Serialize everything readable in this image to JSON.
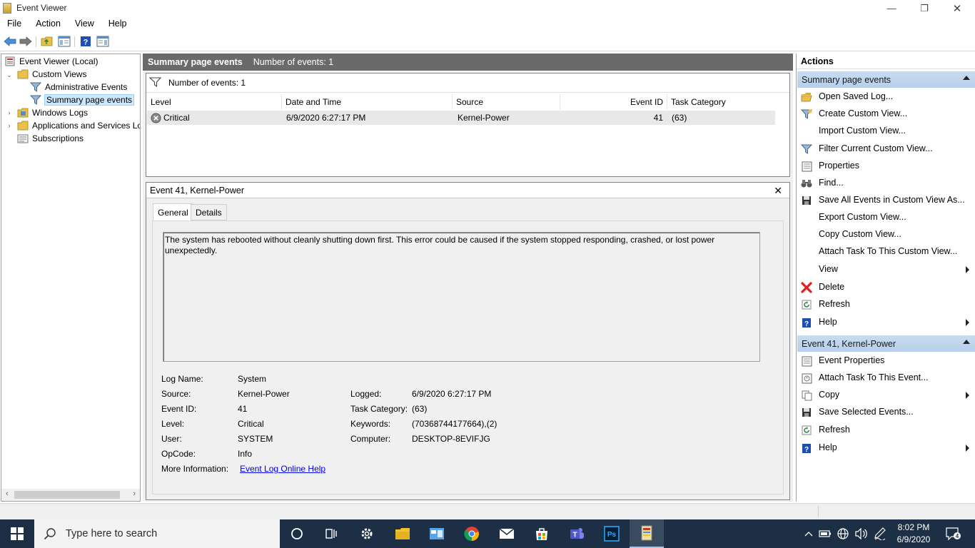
{
  "window": {
    "title": "Event Viewer",
    "controls": {
      "minimize": "—",
      "maximize": "❐",
      "close": "✕"
    }
  },
  "menu": [
    "File",
    "Action",
    "View",
    "Help"
  ],
  "toolbar": {
    "icons": [
      "back-arrow-icon",
      "forward-arrow-icon",
      "folder-up-icon",
      "show-hide-console-tree-icon",
      "help-icon",
      "show-hide-action-pane-icon"
    ]
  },
  "tree": {
    "root": "Event Viewer (Local)",
    "custom_views": "Custom Views",
    "administrative_events": "Administrative Events",
    "summary_page_events": "Summary page events",
    "windows_logs": "Windows Logs",
    "applications_services": "Applications and Services Lo",
    "subscriptions": "Subscriptions",
    "scroll_left": "‹",
    "scroll_right": "›"
  },
  "center": {
    "header_title": "Summary page events",
    "header_count": "Number of events: 1",
    "filter_text": "Number of events: 1",
    "columns": [
      "Level",
      "Date and Time",
      "Source",
      "Event ID",
      "Task Category"
    ],
    "rows": [
      {
        "level": "Critical",
        "datetime": "6/9/2020 6:27:17 PM",
        "source": "Kernel-Power",
        "event_id": "41",
        "task_category": "(63)"
      }
    ]
  },
  "detail": {
    "title": "Event 41, Kernel-Power",
    "close": "✕",
    "tabs": [
      "General",
      "Details"
    ],
    "active_tab": "General",
    "description": "The system has rebooted without cleanly shutting down first. This error could be caused if the system stopped responding, crashed, or lost power unexpectedly.",
    "labels": {
      "log_name": "Log Name:",
      "source": "Source:",
      "event_id": "Event ID:",
      "level": "Level:",
      "user": "User:",
      "opcode": "OpCode:",
      "more_info": "More Information:",
      "logged": "Logged:",
      "task_category": "Task Category:",
      "keywords": "Keywords:",
      "computer": "Computer:"
    },
    "values": {
      "log_name": "System",
      "source": "Kernel-Power",
      "event_id": "41",
      "level": "Critical",
      "user": "SYSTEM",
      "opcode": "Info",
      "more_info_link": "Event Log Online Help",
      "logged": "6/9/2020 6:27:17 PM",
      "task_category": "(63)",
      "keywords": "(70368744177664),(2)",
      "computer": "DESKTOP-8EVIFJG"
    }
  },
  "actions": {
    "title": "Actions",
    "section1": {
      "header": "Summary page events",
      "items": [
        {
          "label": "Open Saved Log...",
          "icon": "open-folder-icon"
        },
        {
          "label": "Create Custom View...",
          "icon": "create-filter-icon"
        },
        {
          "label": "Import Custom View...",
          "icon": ""
        },
        {
          "label": "Filter Current Custom View...",
          "icon": "filter-icon"
        },
        {
          "label": "Properties",
          "icon": "properties-icon"
        },
        {
          "label": "Find...",
          "icon": "binoculars-icon"
        },
        {
          "label": "Save All Events in Custom View As...",
          "icon": "save-icon"
        },
        {
          "label": "Export Custom View...",
          "icon": ""
        },
        {
          "label": "Copy Custom View...",
          "icon": ""
        },
        {
          "label": "Attach Task To This Custom View...",
          "icon": ""
        },
        {
          "label": "View",
          "icon": ""
        },
        {
          "label": "Delete",
          "icon": "delete-icon"
        },
        {
          "label": "Refresh",
          "icon": "refresh-icon"
        },
        {
          "label": "Help",
          "icon": "help-icon"
        }
      ]
    },
    "section2": {
      "header": "Event 41, Kernel-Power",
      "items": [
        {
          "label": "Event Properties",
          "icon": "properties-icon"
        },
        {
          "label": "Attach Task To This Event...",
          "icon": "task-icon"
        },
        {
          "label": "Copy",
          "icon": "copy-icon"
        },
        {
          "label": "Save Selected Events...",
          "icon": "save-icon"
        },
        {
          "label": "Refresh",
          "icon": "refresh-icon"
        },
        {
          "label": "Help",
          "icon": "help-icon"
        }
      ]
    }
  },
  "taskbar": {
    "search_placeholder": "Type here to search",
    "time": "8:02 PM",
    "date": "6/9/2020",
    "notification_count": "4",
    "apps": [
      "cortana-icon",
      "task-view-icon",
      "settings-icon",
      "file-explorer-icon",
      "control-panel-icon",
      "chrome-icon",
      "mail-icon",
      "store-icon",
      "teams-icon",
      "photoshop-icon",
      "event-viewer-icon"
    ],
    "tray_icons": [
      "chevron-up-icon",
      "battery-icon",
      "network-icon",
      "volume-icon",
      "pen-icon",
      "notification-icon"
    ],
    "colors": {
      "taskbar": "#1d2f45",
      "search": "#f3f3f3"
    }
  },
  "colors": {
    "center_header": "#6a6a6a",
    "action_section": "#c9dcf0",
    "selected_tree": "#cce8ff",
    "critical": "#c0392b",
    "delete": "#e02020",
    "refresh": "#2e8b3d",
    "help": "#1e4fb0",
    "link": "#0000ee"
  }
}
